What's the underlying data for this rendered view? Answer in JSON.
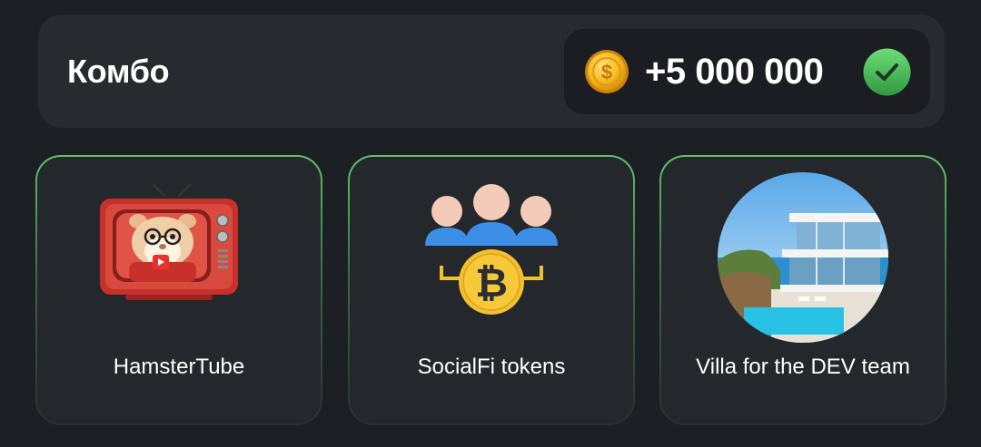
{
  "combo": {
    "title": "Комбо",
    "reward": "+5 000 000",
    "coin_icon": "coin-icon",
    "status_icon": "check-icon",
    "status_color": "#4cbf5a"
  },
  "cards": [
    {
      "label": "HamsterTube",
      "image": "hamster-tv-image"
    },
    {
      "label": "SocialFi tokens",
      "image": "socialfi-bitcoin-image"
    },
    {
      "label": "Villa for the DEV team",
      "image": "villa-image"
    }
  ]
}
